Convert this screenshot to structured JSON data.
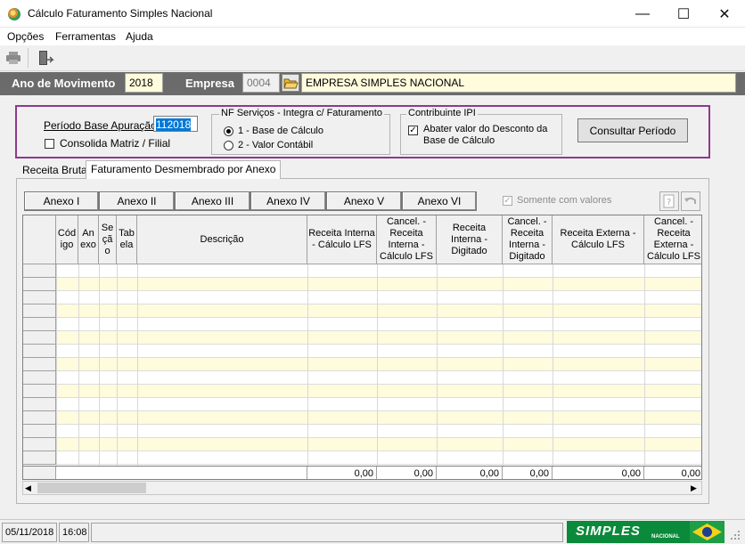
{
  "window": {
    "title": "Cálculo Faturamento Simples Nacional"
  },
  "menu": [
    {
      "label": "Opções"
    },
    {
      "label": "Ferramentas"
    },
    {
      "label": "Ajuda"
    }
  ],
  "header": {
    "ano_label": "Ano de Movimento",
    "ano_value": "2018",
    "empresa_label": "Empresa",
    "empresa_code": "0004",
    "empresa_name": "EMPRESA SIMPLES NACIONAL"
  },
  "periodo": {
    "label": "Período Base Apuração:",
    "value": "112018",
    "consolida_label": "Consolida Matriz / Filial",
    "consolida_checked": false
  },
  "nf": {
    "legend": "NF Serviços - Integra c/ Faturamento",
    "option1": "1 -  Base de Cálculo",
    "option2": "2 -  Valor Contábil",
    "selected": 1
  },
  "ipi": {
    "legend": "Contribuinte IPI",
    "label": "Abater valor do Desconto da Base de Cálculo",
    "checked": true
  },
  "consultar_label": "Consultar Período",
  "tabs": [
    {
      "label": "Receita Bruta"
    },
    {
      "label": "Faturamento Desmembrado por Anexo"
    }
  ],
  "active_tab": 1,
  "anexos": [
    "Anexo I",
    "Anexo II",
    "Anexo III",
    "Anexo IV",
    "Anexo V",
    "Anexo VI"
  ],
  "somente_label": "Somente com valores",
  "columns": [
    "Cód igo",
    "An exo",
    "Se çã o",
    "Tab ela",
    "Descrição",
    "Receita Interna - Cálculo LFS",
    "Cancel. - Receita Interna - Cálculo LFS",
    "Receita Interna - Digitado",
    "Cancel. - Receita Interna - Digitado",
    "Receita Externa - Cálculo LFS",
    "Cancel. - Receita Externa - Cálculo LFS"
  ],
  "totals": [
    "0,00",
    "0,00",
    "0,00",
    "0,00",
    "0,00",
    "0,00"
  ],
  "status": {
    "date": "05/11/2018",
    "time": "16:08",
    "logo_text": "SIMPLES",
    "logo_sub": "NACIONAL"
  },
  "colors": {
    "accent_border": "#8c3a8c",
    "row_yellow": "#fffbdd",
    "logo_green": "#0a8a3a"
  }
}
